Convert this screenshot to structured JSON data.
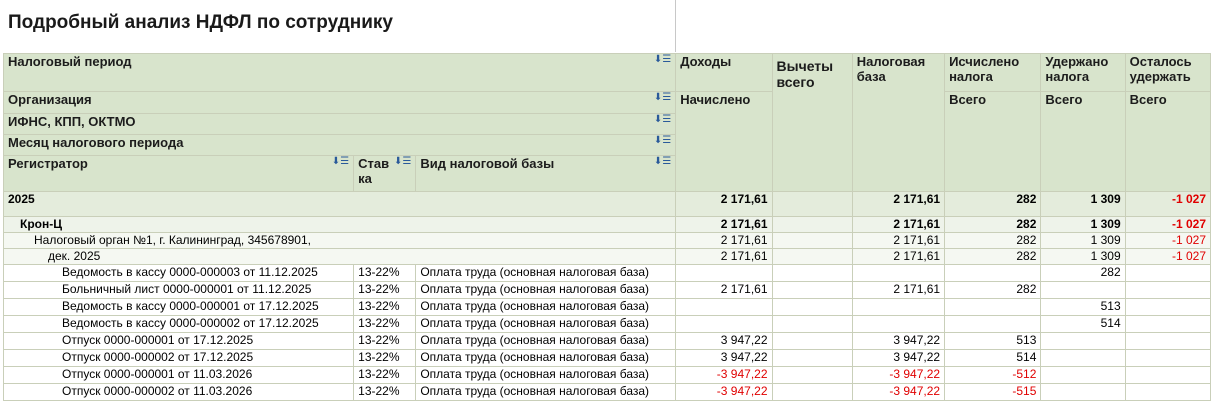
{
  "title": "Подробный анализ НДФЛ по сотруднику",
  "headers": {
    "period": "Налоговый период",
    "org": "Организация",
    "ifns": "ИФНС, КПП, ОКТМО",
    "month": "Месяц налогового периода",
    "registrar": "Регистратор",
    "rate": "Ставка",
    "base_type": "Вид налоговой базы",
    "income": "Доходы",
    "income_sub": "Начислено",
    "deductions": "Вычеты всего",
    "tax_base": "Налоговая база",
    "calculated": "Исчислено налога",
    "calculated_sub": "Всего",
    "withheld": "Удержано налога",
    "withheld_sub": "Всего",
    "remaining": "Осталось удержать",
    "remaining_sub": "Всего"
  },
  "groups": [
    {
      "label": "2025",
      "income": "2 171,61",
      "deductions": "",
      "tax_base": "2 171,61",
      "calculated": "282",
      "withheld": "1 309",
      "remaining": "-1 027"
    },
    {
      "label": "Крон-Ц",
      "income": "2 171,61",
      "deductions": "",
      "tax_base": "2 171,61",
      "calculated": "282",
      "withheld": "1 309",
      "remaining": "-1 027"
    },
    {
      "label": "Налоговый орган №1, г. Калининград, 345678901,",
      "income": "2 171,61",
      "deductions": "",
      "tax_base": "2 171,61",
      "calculated": "282",
      "withheld": "1 309",
      "remaining": "-1 027"
    },
    {
      "label": "дек. 2025",
      "income": "2 171,61",
      "deductions": "",
      "tax_base": "2 171,61",
      "calculated": "282",
      "withheld": "1 309",
      "remaining": "-1 027"
    }
  ],
  "rows": [
    {
      "registrar": "Ведомость в кассу 0000-000003 от 11.12.2025",
      "rate": "13-22%",
      "base_type": "Оплата труда (основная налоговая база)",
      "income": "",
      "deductions": "",
      "tax_base": "",
      "calculated": "",
      "withheld": "282",
      "remaining": ""
    },
    {
      "registrar": "Больничный лист 0000-000001 от 11.12.2025",
      "rate": "13-22%",
      "base_type": "Оплата труда (основная налоговая база)",
      "income": "2 171,61",
      "deductions": "",
      "tax_base": "2 171,61",
      "calculated": "282",
      "withheld": "",
      "remaining": ""
    },
    {
      "registrar": "Ведомость в кассу 0000-000001 от 17.12.2025",
      "rate": "13-22%",
      "base_type": "Оплата труда (основная налоговая база)",
      "income": "",
      "deductions": "",
      "tax_base": "",
      "calculated": "",
      "withheld": "513",
      "remaining": ""
    },
    {
      "registrar": "Ведомость в кассу 0000-000002 от 17.12.2025",
      "rate": "13-22%",
      "base_type": "Оплата труда (основная налоговая база)",
      "income": "",
      "deductions": "",
      "tax_base": "",
      "calculated": "",
      "withheld": "514",
      "remaining": ""
    },
    {
      "registrar": "Отпуск 0000-000001 от 17.12.2025",
      "rate": "13-22%",
      "base_type": "Оплата труда (основная налоговая база)",
      "income": "3 947,22",
      "deductions": "",
      "tax_base": "3 947,22",
      "calculated": "513",
      "withheld": "",
      "remaining": ""
    },
    {
      "registrar": "Отпуск 0000-000002 от 17.12.2025",
      "rate": "13-22%",
      "base_type": "Оплата труда (основная налоговая база)",
      "income": "3 947,22",
      "deductions": "",
      "tax_base": "3 947,22",
      "calculated": "514",
      "withheld": "",
      "remaining": ""
    },
    {
      "registrar": "Отпуск 0000-000001 от 11.03.2026",
      "rate": "13-22%",
      "base_type": "Оплата труда (основная налоговая база)",
      "income": "-3 947,22",
      "deductions": "",
      "tax_base": "-3 947,22",
      "calculated": "-512",
      "withheld": "",
      "remaining": ""
    },
    {
      "registrar": "Отпуск 0000-000002 от 11.03.2026",
      "rate": "13-22%",
      "base_type": "Оплата труда (основная налоговая база)",
      "income": "-3 947,22",
      "deductions": "",
      "tax_base": "-3 947,22",
      "calculated": "-515",
      "withheld": "",
      "remaining": ""
    }
  ],
  "icons": {
    "sort": "sort-icon"
  },
  "colors": {
    "header_bg": "#d8e4cc",
    "negative": "#e00000"
  }
}
